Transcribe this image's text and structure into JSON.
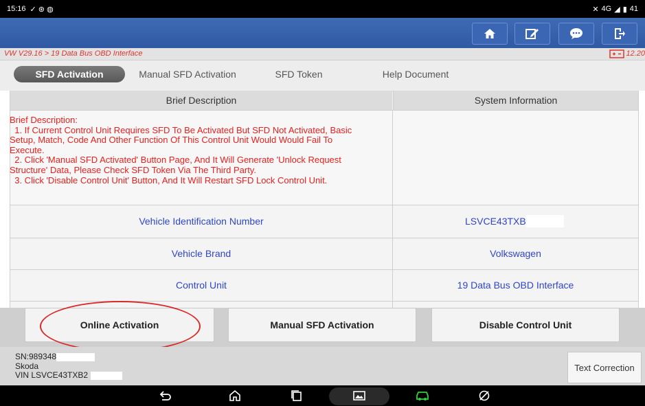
{
  "status_bar": {
    "time": "15:16",
    "right_text": "4G",
    "battery": "41"
  },
  "toolbar": {
    "icons": [
      "home-icon",
      "edit-note-icon",
      "chat-bubble-icon",
      "exit-door-icon"
    ]
  },
  "breadcrumb": {
    "path": "VW V29.16 > 19 Data Bus OBD Interface",
    "version": "12.20"
  },
  "tabs": [
    {
      "label": "SFD Activation",
      "active": true
    },
    {
      "label": "Manual SFD Activation",
      "active": false
    },
    {
      "label": "SFD Token",
      "active": false
    },
    {
      "label": "Help Document",
      "active": false
    }
  ],
  "table": {
    "headers": [
      "Brief Description",
      "System Information"
    ],
    "brief_lines": [
      "Brief Description:",
      "  1. If Current Control Unit Requires SFD To Be Activated But SFD Not Activated, Basic",
      "Setup, Match, Code And Other Function Of This Control Unit Would Would Fail To",
      "Execute.",
      "  2. Click 'Manual SFD Activated' Button Page, And It Will Generate 'Unlock Request",
      "Structure' Data, Please Check SFD Token Via The Third Party.",
      "  3. Click 'Disable Control Unit' Button, And It Will Restart SFD Lock Control Unit."
    ],
    "rows": [
      {
        "label": "Vehicle Identification Number",
        "value": "LSVCE43TXB"
      },
      {
        "label": "Vehicle Brand",
        "value": "Volkswagen"
      },
      {
        "label": "Control Unit",
        "value": "19 Data Bus OBD Interface"
      }
    ]
  },
  "actions": {
    "online": "Online Activation",
    "manual": "Manual SFD Activation",
    "disable": "Disable Control Unit"
  },
  "footer": {
    "sn": "SN:989348",
    "make": "Skoda",
    "vin": "VIN LSVCE43TXB2",
    "text_correction": "Text Correction"
  },
  "colors": {
    "accent_blue": "#2f5aa3",
    "red_text": "#e8201e",
    "link_blue": "#2f46c8"
  }
}
